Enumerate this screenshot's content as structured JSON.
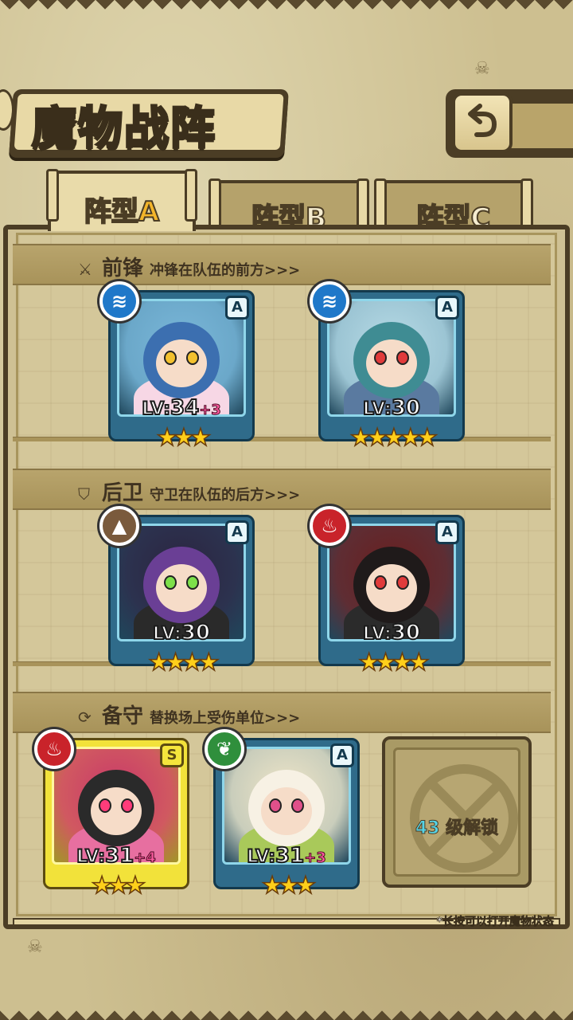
{
  "title": "魔物战阵",
  "tabs": [
    {
      "prefix": "阵型",
      "letter": "A"
    },
    {
      "prefix": "阵型",
      "letter": "B"
    },
    {
      "prefix": "阵型",
      "letter": "C"
    }
  ],
  "sections": {
    "front": {
      "title": "前锋",
      "desc": "冲锋在队伍的前方>>>"
    },
    "rear": {
      "title": "后卫",
      "desc": "守卫在队伍的后方>>>"
    },
    "reserve": {
      "title": "备守",
      "desc": "替换场上受伤单位>>>"
    }
  },
  "cards": [
    {
      "element": "water",
      "element_icon": "water-wave-icon",
      "rank": "A",
      "lv_prefix": "LV:",
      "level": "34",
      "bonus": "+3",
      "stars": "★★★",
      "star_count": 3,
      "palette": {
        "bg": "#7ab7d9",
        "head": "#3c6fb0",
        "body": "#f7d7e5",
        "eye": "#f3c12e"
      }
    },
    {
      "element": "water",
      "element_icon": "water-wave-icon",
      "rank": "A",
      "lv_prefix": "LV:",
      "level": "30",
      "bonus": "",
      "stars": "★★★★★",
      "star_count": 5,
      "palette": {
        "bg": "#b7dbe6",
        "head": "#3f8c93",
        "body": "#5a7aa0",
        "eye": "#e03b3b"
      }
    },
    {
      "element": "earth",
      "element_icon": "mountain-icon",
      "rank": "A",
      "lv_prefix": "LV:",
      "level": "30",
      "bonus": "",
      "stars": "★★★★",
      "star_count": 4,
      "palette": {
        "bg": "#2b2440",
        "head": "#6a3f95",
        "body": "#2a2a2a",
        "eye": "#7de04a"
      }
    },
    {
      "element": "fire",
      "element_icon": "flame-icon",
      "rank": "A",
      "lv_prefix": "LV:",
      "level": "30",
      "bonus": "",
      "stars": "★★★★",
      "star_count": 4,
      "palette": {
        "bg": "#6a1e1e",
        "head": "#1f1a1a",
        "body": "#2b2b2b",
        "eye": "#e03b3b"
      }
    },
    {
      "element": "fire",
      "element_icon": "flame-icon",
      "rank": "S",
      "lv_prefix": "LV:",
      "level": "31",
      "bonus": "+4",
      "stars": "★★★",
      "star_count": 3,
      "palette": {
        "bg": "#c8376a",
        "head": "#2a2a2a",
        "body": "#e76fa0",
        "eye": "#ff3c7a"
      }
    },
    {
      "element": "wood",
      "element_icon": "leaf-icon",
      "rank": "A",
      "lv_prefix": "LV:",
      "level": "31",
      "bonus": "+3",
      "stars": "★★★",
      "star_count": 3,
      "palette": {
        "bg": "#f0e6c8",
        "head": "#f7f1e4",
        "body": "#a9c95a",
        "eye": "#e0508a"
      }
    }
  ],
  "locked_slot": {
    "level": "43",
    "text": "级解锁"
  },
  "footnote": "*长按可以打开魔物状态",
  "colors": {
    "frame": "#4b3d25",
    "parchment": "#cdbf90",
    "card_blue": "#2f6b8a",
    "card_gold": "#f2e23a",
    "star": "#ffcf1a"
  }
}
